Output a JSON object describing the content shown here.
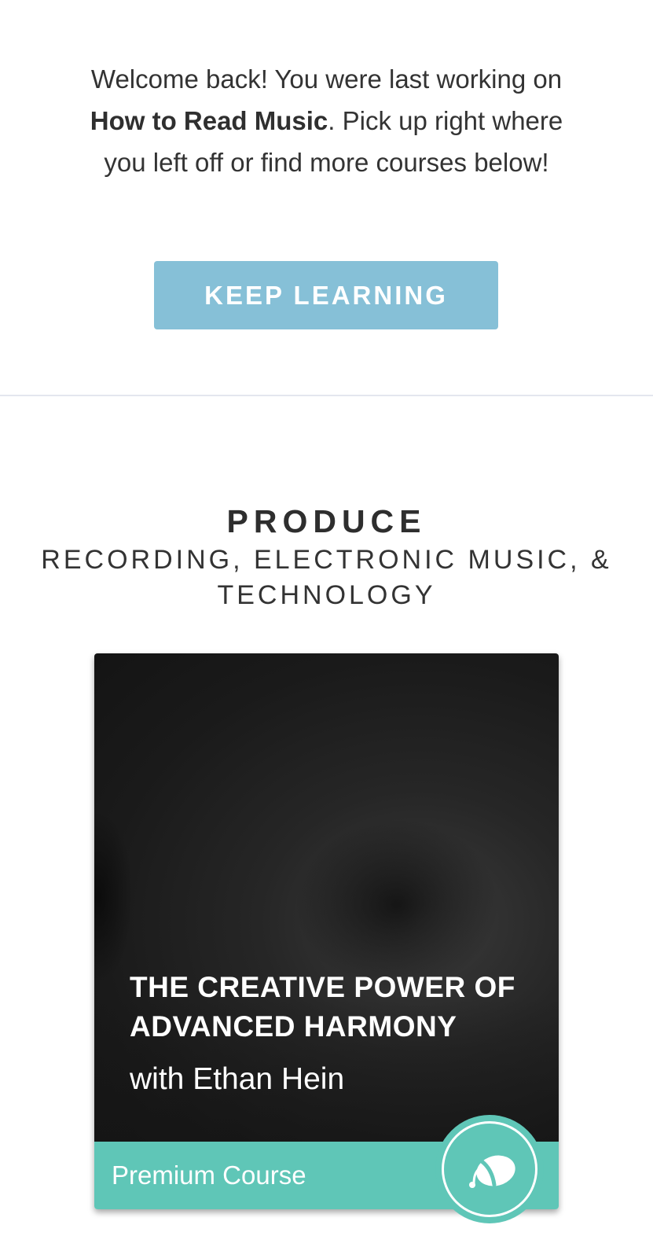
{
  "welcome": {
    "text_before": "Welcome back! You were last working on ",
    "last_course": "How to Read Music",
    "text_after": ". Pick up right where you left off or find more courses below!",
    "button_label": "KEEP LEARNING"
  },
  "category": {
    "title": "PRODUCE",
    "subtitle": "RECORDING, ELECTRONIC MUSIC, & TECHNOLOGY"
  },
  "course": {
    "title": "THE CREATIVE POWER OF ADVANCED HARMONY",
    "author": "with Ethan Hein",
    "tier_label": "Premium Course",
    "badge_icon": "music-note-logo-icon"
  },
  "colors": {
    "button_blue": "#86c0d7",
    "premium_teal": "#5fc6b7"
  }
}
